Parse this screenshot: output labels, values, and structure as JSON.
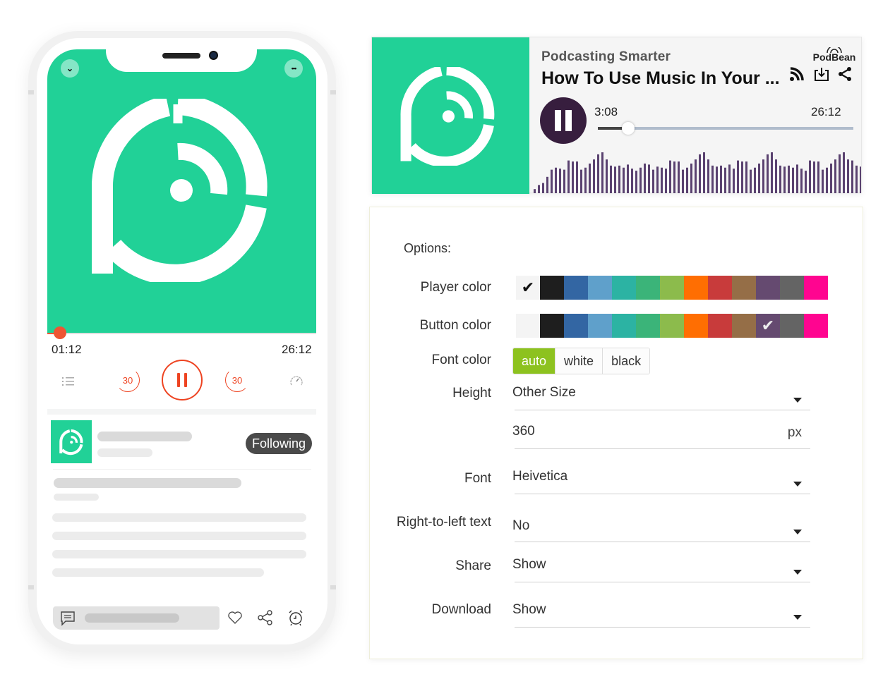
{
  "phone": {
    "top_buttons": {
      "collapse_icon": "chevron-down-icon",
      "more_icon": "more-dots-icon",
      "collapse_glyph": "⌄",
      "more_glyph": "•••"
    },
    "progress": {
      "fraction": 0.046,
      "elapsed": "01:12",
      "duration": "26:12"
    },
    "controls": {
      "skip_back_label": "30",
      "skip_forward_label": "30",
      "playlist_icon": "list-icon",
      "speed_icon": "speedometer-icon"
    },
    "podcast": {
      "follow_label": "Following"
    },
    "bottom_bar": {
      "comment_icon": "comment-icon",
      "like_icon": "heart-icon",
      "share_icon": "share-icon",
      "sleep_icon": "alarm-clock-icon"
    }
  },
  "player": {
    "podcast_name": "Podcasting  Smarter",
    "episode_title": "How To Use Music In Your ...",
    "brand": "PodBean",
    "icons": [
      "rss-icon",
      "download-icon",
      "share-icon"
    ],
    "elapsed": "3:08",
    "duration": "26:12",
    "progress_fraction": 0.12,
    "accent_color": "#371e3e",
    "waveform": [
      4,
      8,
      10,
      16,
      23,
      25,
      24,
      23,
      32,
      31,
      31,
      23,
      25,
      29,
      33,
      38,
      40,
      33,
      27,
      26,
      27,
      25,
      28,
      24,
      22,
      25,
      29,
      28,
      23,
      26,
      25,
      24,
      32,
      31,
      31,
      23,
      25,
      29,
      33,
      38,
      40,
      33,
      27,
      26,
      27,
      25,
      28,
      24,
      32,
      31,
      31,
      23,
      25,
      29,
      33,
      38,
      40,
      33,
      27,
      26,
      27,
      25,
      28,
      24,
      22,
      32,
      31,
      31,
      23,
      25,
      29,
      33,
      38,
      40,
      33,
      32,
      27,
      26
    ]
  },
  "options": {
    "title": "Options:",
    "player_color": {
      "label": "Player color",
      "swatches": [
        "#f4f4f4",
        "#1e1e1e",
        "#3366a3",
        "#5fa0cb",
        "#2cb3a3",
        "#3bb479",
        "#8cbb4c",
        "#ff6e02",
        "#c83b3b",
        "#956e47",
        "#654a70",
        "#646464",
        "#ff0590"
      ],
      "selected_index": 0
    },
    "button_color": {
      "label": "Button  color",
      "swatches": [
        "#f4f4f4",
        "#1e1e1e",
        "#3366a3",
        "#5fa0cb",
        "#2cb3a3",
        "#3bb479",
        "#8cbb4c",
        "#ff6e02",
        "#c83b3b",
        "#956e47",
        "#654a70",
        "#646464",
        "#ff0590"
      ],
      "selected_index": 10
    },
    "font_color": {
      "label": "Font color",
      "choices": [
        "auto",
        "white",
        "black"
      ],
      "selected": "auto",
      "active_color": "#8dc21f"
    },
    "height": {
      "label": "Height",
      "value": "Other  Size",
      "custom_value": "360",
      "unit": "px"
    },
    "font": {
      "label": "Font",
      "value": "Heivetica"
    },
    "rtl": {
      "label": "Right-to-left text",
      "value": "No"
    },
    "share": {
      "label": "Share",
      "value": "Show"
    },
    "download": {
      "label": "Download",
      "value": "Show"
    }
  }
}
